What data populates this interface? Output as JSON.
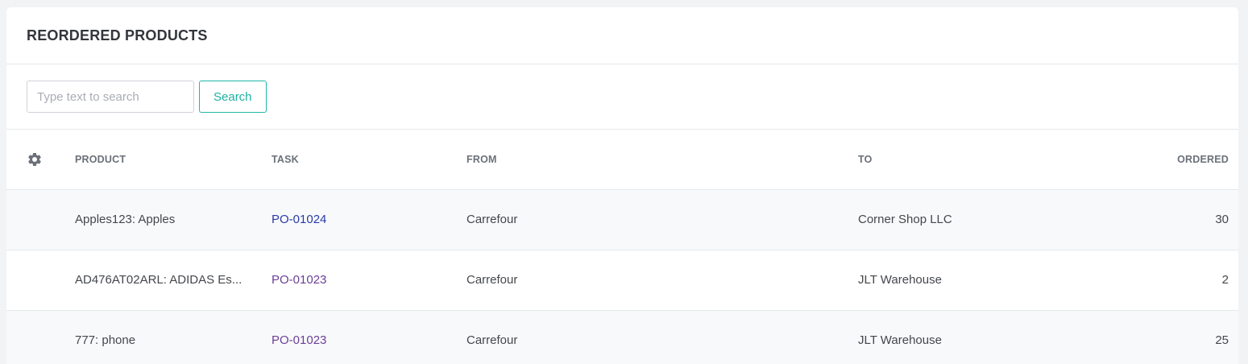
{
  "card": {
    "title": "REORDERED PRODUCTS"
  },
  "search": {
    "placeholder": "Type text to search",
    "value": "",
    "button_label": "Search"
  },
  "table": {
    "columns": {
      "settings_icon": "gear-icon",
      "product": "PRODUCT",
      "task": "TASK",
      "from": "FROM",
      "to": "TO",
      "ordered": "ORDERED"
    },
    "rows": [
      {
        "product": "Apples123: Apples",
        "task": "PO-01024",
        "from": "Carrefour",
        "to": "Corner Shop LLC",
        "ordered": "30"
      },
      {
        "product": "AD476AT02ARL: ADIDAS Es...",
        "task": "PO-01023",
        "from": "Carrefour",
        "to": "JLT Warehouse",
        "ordered": "2"
      },
      {
        "product": "777: phone",
        "task": "PO-01023",
        "from": "Carrefour",
        "to": "JLT Warehouse",
        "ordered": "25"
      }
    ]
  },
  "colors": {
    "accent": "#1fb0a0",
    "link": "#2a3aa6",
    "link_visited": "#6a3f96"
  }
}
